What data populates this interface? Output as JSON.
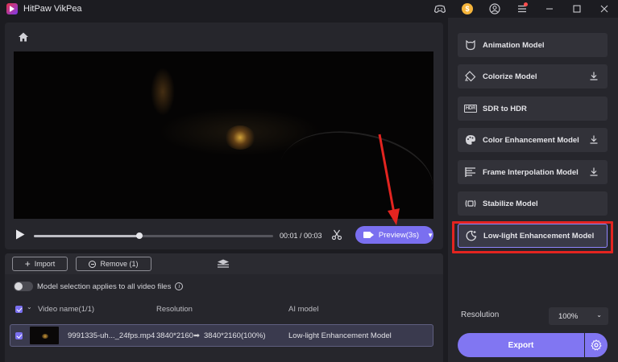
{
  "window": {
    "title": "HitPaw VikPea",
    "coin_label": "$"
  },
  "player": {
    "time": "00:01 / 00:03",
    "progress": 0.44,
    "preview_label": "Preview(3s)"
  },
  "list_toolbar": {
    "import_label": "Import",
    "remove_label": "Remove (1)"
  },
  "toggle": {
    "label": "Model selection applies to all video files",
    "info": "i"
  },
  "table": {
    "headers": {
      "name": "Video name(1/1)",
      "resolution": "Resolution",
      "model": "AI model"
    },
    "rows": [
      {
        "name": "9991335-uh..._24fps.mp4",
        "from_res": "3840*2160",
        "arrow": "➡",
        "to_res": "3840*2160(100%)",
        "model": "Low-light Enhancement Model"
      }
    ]
  },
  "models": [
    {
      "label": "Animation Model",
      "icon": "cat-face-icon",
      "download": false
    },
    {
      "label": "Colorize Model",
      "icon": "paint-bucket-icon",
      "download": true
    },
    {
      "label": "SDR to HDR",
      "icon": "hdr-icon",
      "icon_text": "HDR",
      "download": false
    },
    {
      "label": "Color Enhancement Model",
      "icon": "palette-icon",
      "download": true
    },
    {
      "label": "Frame Interpolation Model",
      "icon": "frame-lines-icon",
      "download": true
    },
    {
      "label": "Stabilize Model",
      "icon": "stabilize-icon",
      "download": false
    },
    {
      "label": "Low-light Enhancement Model",
      "icon": "moon-sparkle-icon",
      "download": false,
      "selected": true
    }
  ],
  "output": {
    "resolution_label": "Resolution",
    "resolution_value": "100%",
    "export_label": "Export"
  },
  "colors": {
    "accent": "#8176f2",
    "highlight": "#e32420"
  }
}
